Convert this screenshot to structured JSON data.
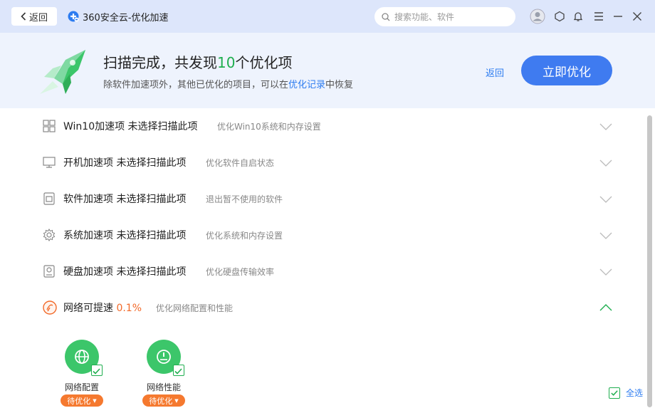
{
  "titlebar": {
    "back_label": "返回",
    "title": "360安全云-优化加速",
    "search_placeholder": "搜索功能、软件"
  },
  "header": {
    "title_prefix": "扫描完成，共发现",
    "title_count": "10",
    "title_suffix": "个优化项",
    "sub_prefix": "除软件加速项外，其他已优化的项目，可以在",
    "sub_link": "优化记录",
    "sub_suffix": "中恢复",
    "back_label": "返回",
    "optimize_label": "立即优化"
  },
  "rows": [
    {
      "name": "Win10加速项 未选择扫描此项",
      "desc": "优化Win10系统和内存设置",
      "icon": "windows-icon"
    },
    {
      "name": "开机加速项 未选择扫描此项",
      "desc": "优化软件自启状态",
      "icon": "monitor-icon"
    },
    {
      "name": "软件加速项 未选择扫描此项",
      "desc": "退出暂不使用的软件",
      "icon": "software-icon"
    },
    {
      "name": "系统加速项 未选择扫描此项",
      "desc": "优化系统和内存设置",
      "icon": "gear-icon"
    },
    {
      "name": "硬盘加速项 未选择扫描此项",
      "desc": "优化硬盘传输效率",
      "icon": "disk-icon"
    },
    {
      "name": "网络可提速",
      "pct": "0.1%",
      "desc": "优化网络配置和性能",
      "icon": "network-icon"
    }
  ],
  "network_items": [
    {
      "label": "网络配置",
      "status": "待优化",
      "icon": "globe-icon",
      "checked": true
    },
    {
      "label": "网络性能",
      "status": "待优化",
      "icon": "speedometer-icon",
      "checked": true
    }
  ],
  "select_all_label": "全选",
  "colors": {
    "accent_blue": "#3f7bf0",
    "green": "#3cc66a",
    "orange": "#f5792f",
    "highlight_green": "#1fae4f"
  }
}
